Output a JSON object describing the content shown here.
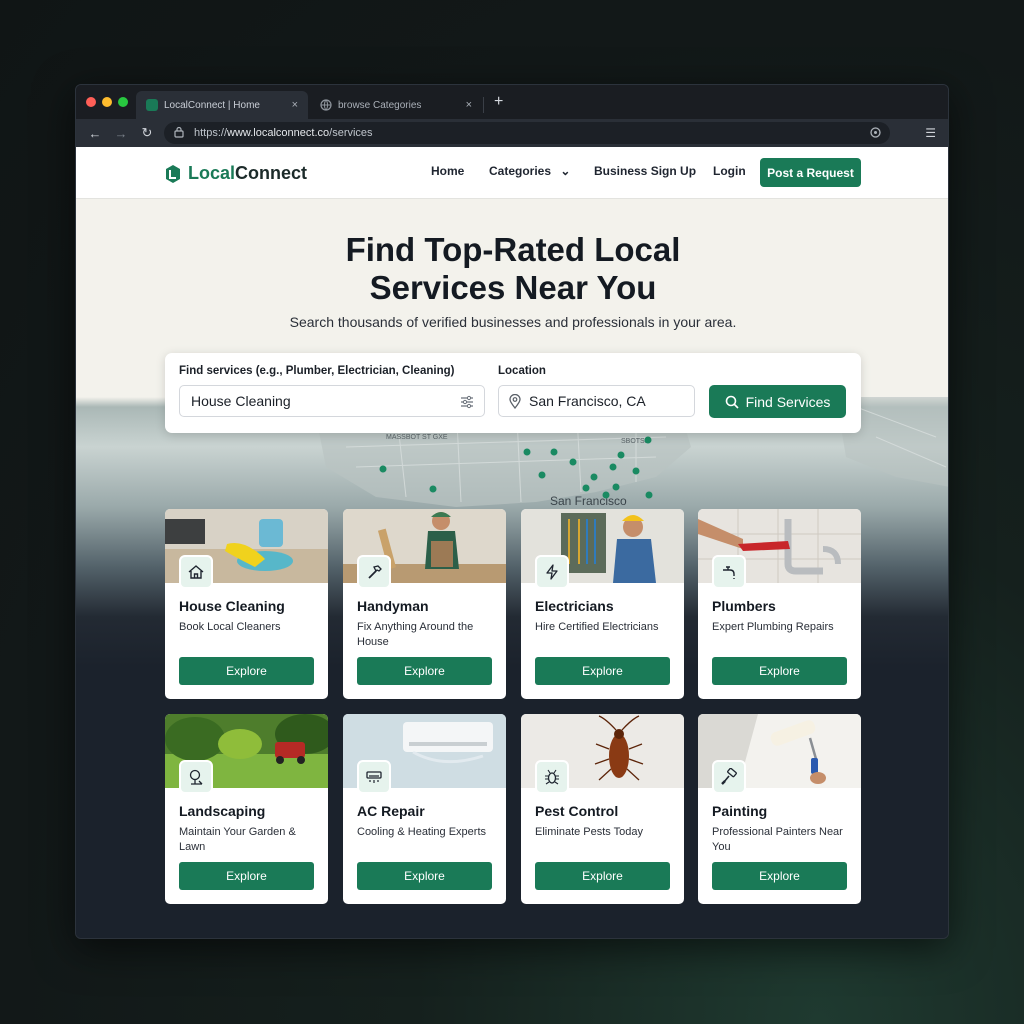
{
  "browser": {
    "tabs": [
      {
        "label": "LocalConnect | Home",
        "close": "×"
      },
      {
        "label": "browse Categories",
        "close": "×"
      }
    ],
    "new_tab": "+",
    "url_prefix": "https://",
    "url_host": "www.localconnect.co",
    "url_path": "/services",
    "menu": "☰",
    "back": "←",
    "forward": "→",
    "reload": "↻"
  },
  "header": {
    "logo_accent": "Local",
    "logo_rest": "Connect",
    "nav": [
      "Home",
      "Categories",
      "Business Sign Up",
      "Login"
    ],
    "categories_caret": "⌄",
    "post_request": "Post a Request"
  },
  "hero": {
    "title_line1": "Find Top-Rated Local",
    "title_line2": "Services Near You",
    "subtitle": "Search thousands of verified businesses and professionals in your area."
  },
  "search": {
    "service_label": "Find services (e.g., Plumber, Electrician, Cleaning)",
    "service_value": "House Cleaning",
    "location_label": "Location",
    "location_value": "San Francisco, CA",
    "button": "Find Services"
  },
  "map": {
    "city_label": "San Francisco",
    "street_label": "MASSBOT ST GXE",
    "street_label2": "SBOTSB"
  },
  "categories": [
    {
      "title": "House Cleaning",
      "desc": "Book Local Cleaners",
      "button": "Explore",
      "icon": "house-icon"
    },
    {
      "title": "Handyman",
      "desc": "Fix Anything Around the House",
      "button": "Explore",
      "icon": "hammer-icon"
    },
    {
      "title": "Electricians",
      "desc": "Hire Certified Electricians",
      "button": "Explore",
      "icon": "lightning-icon"
    },
    {
      "title": "Plumbers",
      "desc": "Expert Plumbing Repairs",
      "button": "Explore",
      "icon": "faucet-icon"
    },
    {
      "title": "Landscaping",
      "desc": "Maintain Your Garden & Lawn",
      "button": "Explore",
      "icon": "tree-icon"
    },
    {
      "title": "AC Repair",
      "desc": "Cooling & Heating Experts",
      "button": "Explore",
      "icon": "air-conditioner-icon"
    },
    {
      "title": "Pest Control",
      "desc": "Eliminate Pests Today",
      "button": "Explore",
      "icon": "bug-icon"
    },
    {
      "title": "Painting",
      "desc": "Professional Painters Near You",
      "button": "Explore",
      "icon": "paint-roller-icon"
    }
  ],
  "colors": {
    "brand_green": "#1a7a57",
    "icon_bg": "#e6f3ed"
  }
}
